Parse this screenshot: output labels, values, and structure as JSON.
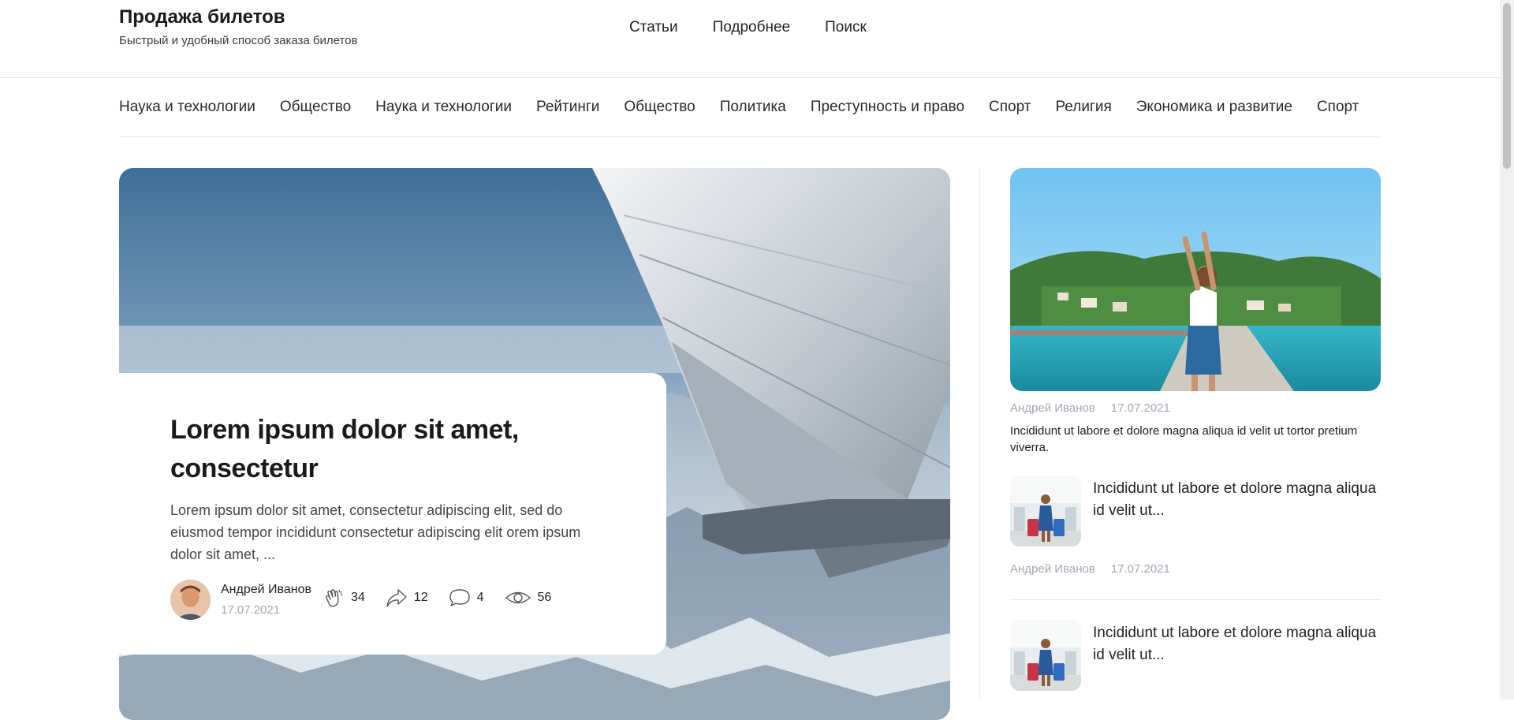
{
  "header": {
    "title": "Продажа билетов",
    "subtitle": "Быстрый и удобный способ заказа билетов",
    "nav": [
      "Статьи",
      "Подробнее",
      "Поиск"
    ]
  },
  "categories": [
    "Наука и технологии",
    "Общество",
    "Наука и технологии",
    "Рейтинги",
    "Общество",
    "Политика",
    "Преступность и право",
    "Спорт",
    "Религия",
    "Экономика и развитие",
    "Спорт"
  ],
  "featured": {
    "title": "Lorem ipsum dolor sit amet, consectetur",
    "excerpt": "Lorem ipsum dolor sit amet, consectetur adipiscing elit, sed do eiusmod tempor incididunt consectetur adipiscing elit orem ipsum dolor sit amet, ...",
    "author": "Андрей Иванов",
    "date": "17.07.2021",
    "stats": {
      "claps": "34",
      "shares": "12",
      "comments": "4",
      "views": "56"
    }
  },
  "sidebar": {
    "top": {
      "author": "Андрей Иванов",
      "date": "17.07.2021",
      "text": "Incididunt ut labore et dolore magna aliqua id velit ut tortor pretium viverra."
    },
    "items": [
      {
        "title": "Incididunt ut labore et dolore magna aliqua id velit ut...",
        "author": "Андрей Иванов",
        "date": "17.07.2021"
      },
      {
        "title": "Incididunt ut labore et dolore magna aliqua id velit ut..."
      }
    ]
  },
  "icons": {
    "claps": "clap-icon",
    "shares": "share-icon",
    "comments": "comment-icon",
    "views": "eye-icon"
  }
}
